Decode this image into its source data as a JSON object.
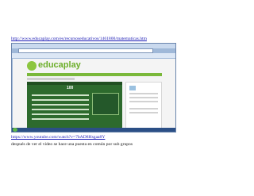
{
  "links": {
    "top": "http://www.educaplay.com/es/recursoseducativos/1461800/matematicas.htm",
    "bottom": "https://www.youtube.com/watch?v=7bAD8Hsgaa8Y"
  },
  "caption": "después de ver el video se hace una puesta en común por sub grupos",
  "screenshot": {
    "logo_text": "educaplay",
    "score": "100",
    "colors": {
      "brand_green": "#6cae2a",
      "game_green": "#2d6a2d",
      "taskbar_blue": "#2b4f86"
    }
  }
}
